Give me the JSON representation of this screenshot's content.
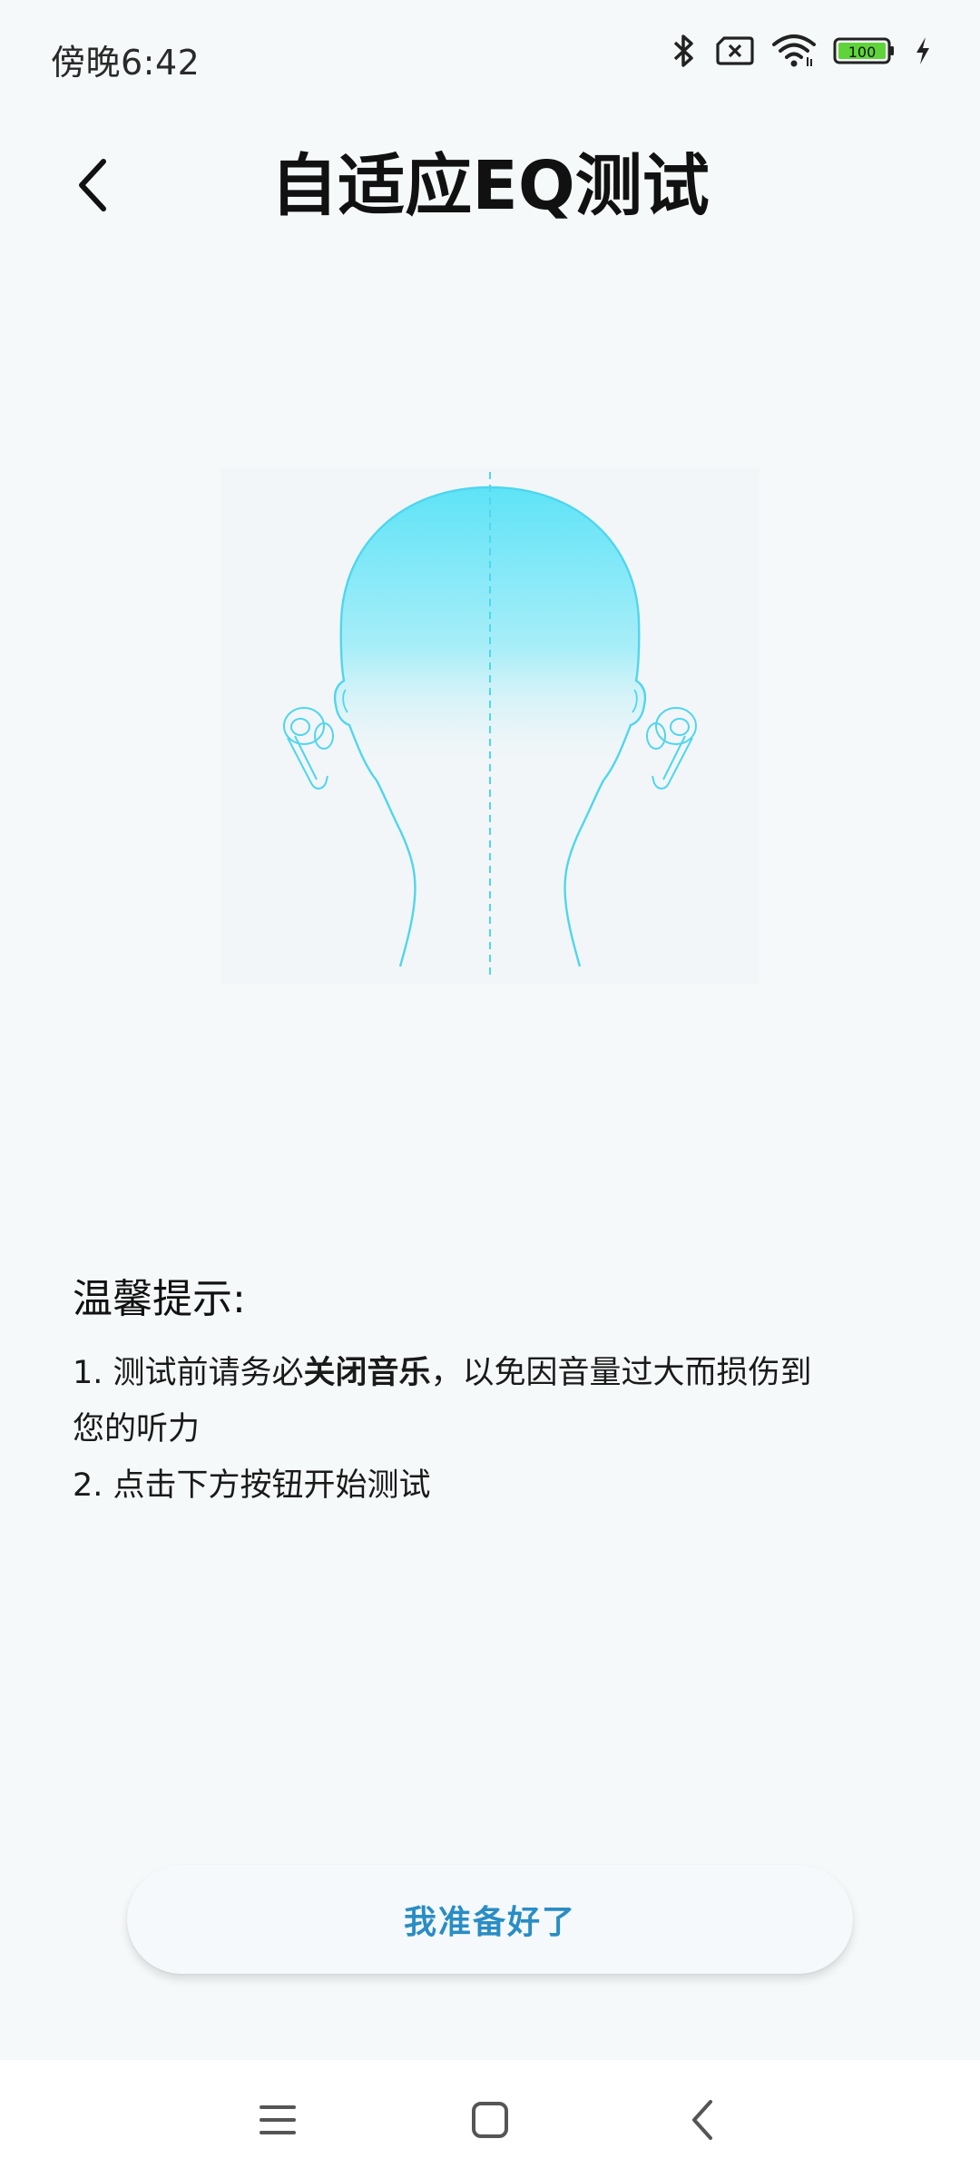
{
  "status_bar": {
    "time": "傍晚6:42",
    "battery": "100",
    "icons": [
      "bluetooth-icon",
      "sim-x-icon",
      "wifi-icon",
      "battery-icon",
      "charging-icon"
    ]
  },
  "header": {
    "title": "自适应EQ测试",
    "back_icon": "chevron-left-icon"
  },
  "illustration": {
    "icon": "head-with-earbuds-icon",
    "head_color": "#5fe3f7"
  },
  "tips": {
    "title": "温馨提示:",
    "line1_prefix": "1. 测试前请务必",
    "line1_bold": "关闭音乐",
    "line1_suffix": "，以免因音量过大而损伤到",
    "line1_cont": "您的听力",
    "line2": "2. 点击下方按钮开始测试"
  },
  "action": {
    "ready_label": "我准备好了",
    "accent": "#2a8dc4"
  },
  "nav": {
    "icons": [
      "menu-icon",
      "home-icon",
      "back-icon"
    ]
  }
}
